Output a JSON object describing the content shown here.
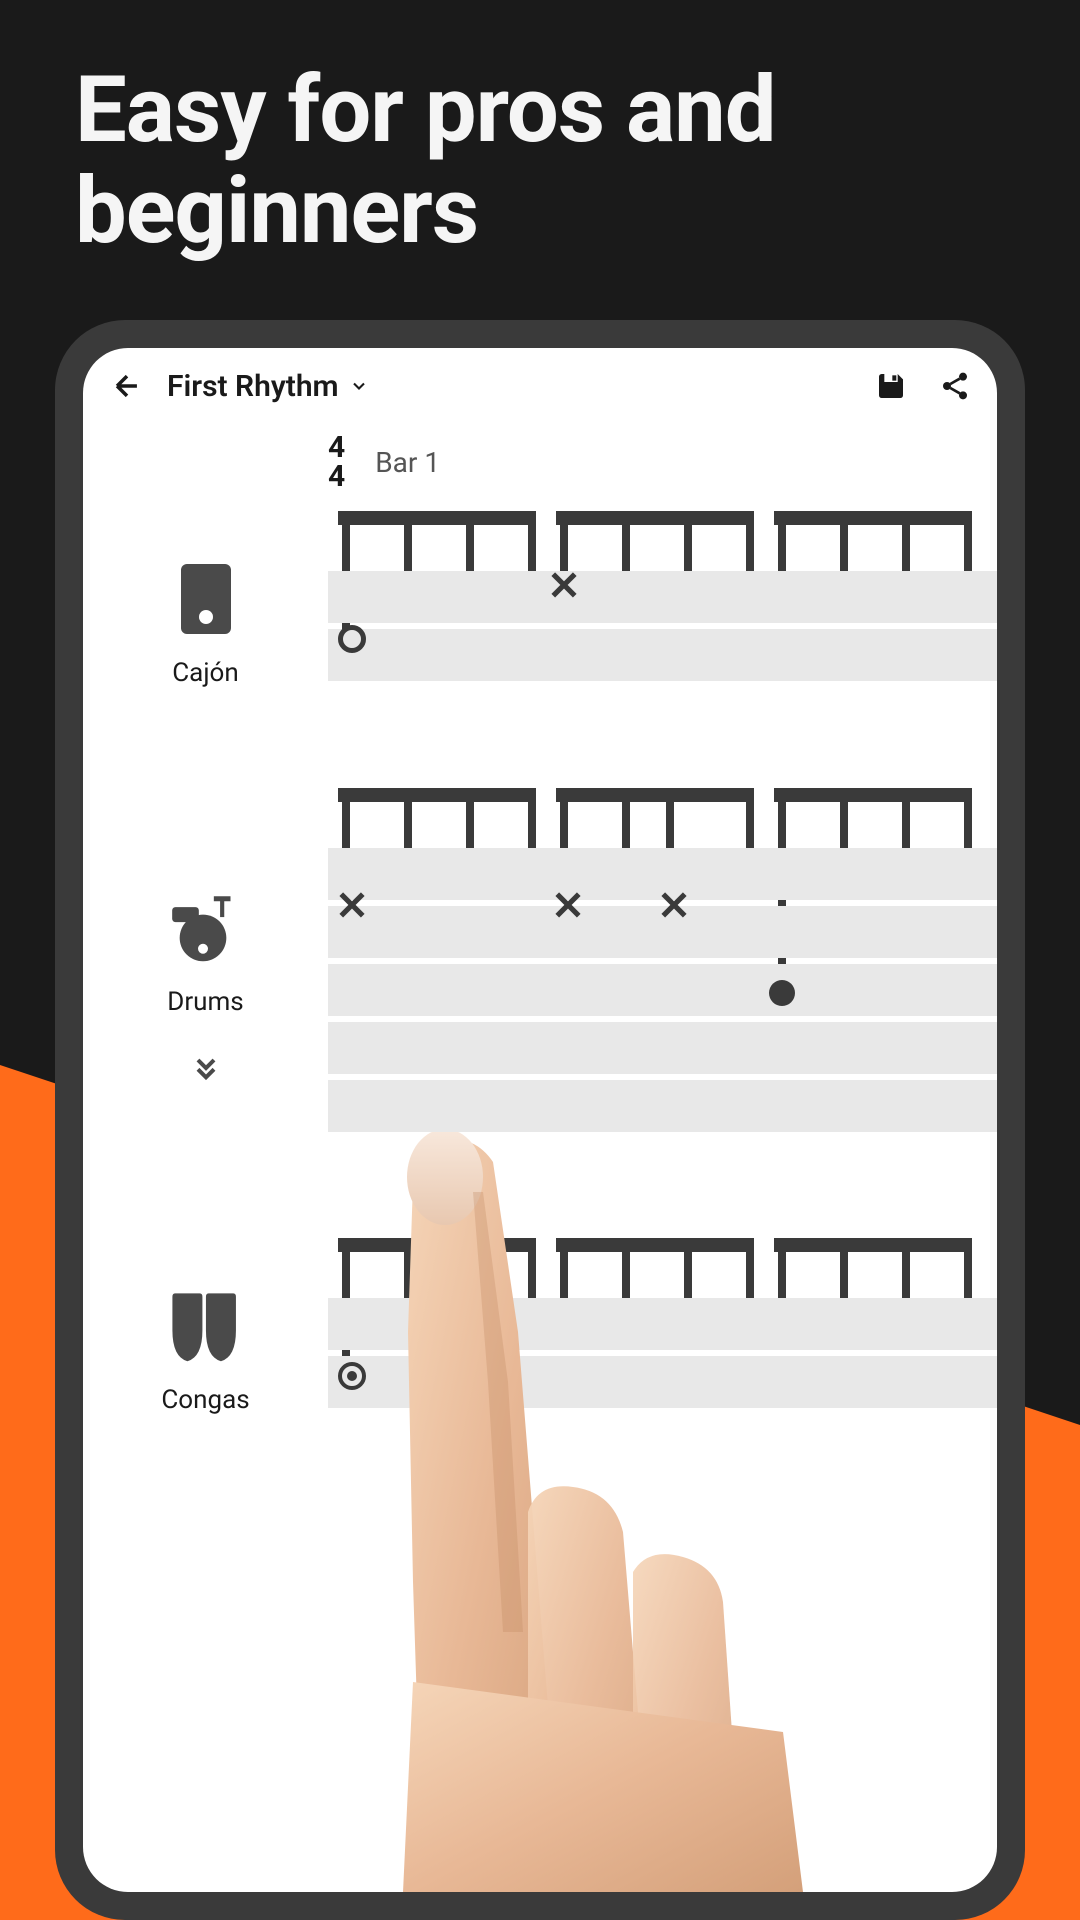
{
  "headline": "Easy for pros and beginners",
  "header": {
    "title": "First Rhythm"
  },
  "timeSignature": {
    "top": "4",
    "bottom": "4"
  },
  "barLabel": "Bar 1",
  "instruments": [
    {
      "name": "Cajón",
      "icon": "cajon"
    },
    {
      "name": "Drums",
      "icon": "drums",
      "expandable": true
    },
    {
      "name": "Congas",
      "icon": "congas"
    }
  ]
}
